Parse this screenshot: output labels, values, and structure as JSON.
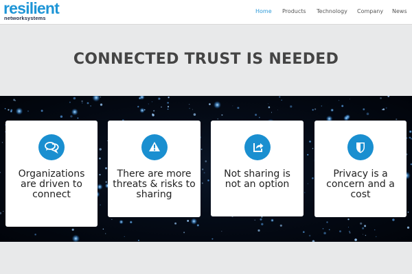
{
  "brand": {
    "name": "resilient",
    "tagline": "networksystems",
    "color": "#1e95d6"
  },
  "nav": {
    "items": [
      {
        "label": "Home",
        "active": true
      },
      {
        "label": "Products",
        "active": false
      },
      {
        "label": "Technology",
        "active": false
      },
      {
        "label": "Company",
        "active": false
      },
      {
        "label": "News",
        "active": false
      }
    ],
    "active_color": "#2d9ad8"
  },
  "hero": {
    "title": "CONNECTED TRUST IS NEEDED"
  },
  "cards": [
    {
      "icon": "chat-bubbles-icon",
      "text": "Organizations are driven to connect"
    },
    {
      "icon": "warning-icon",
      "text": "There are more threats & risks to sharing"
    },
    {
      "icon": "share-icon",
      "text": "Not sharing is not an option"
    },
    {
      "icon": "shield-icon",
      "text": "Privacy is a concern and a cost"
    }
  ],
  "colors": {
    "accent": "#1a8fd0",
    "band_background": "#040a15",
    "page_background": "#e8e9ea"
  }
}
